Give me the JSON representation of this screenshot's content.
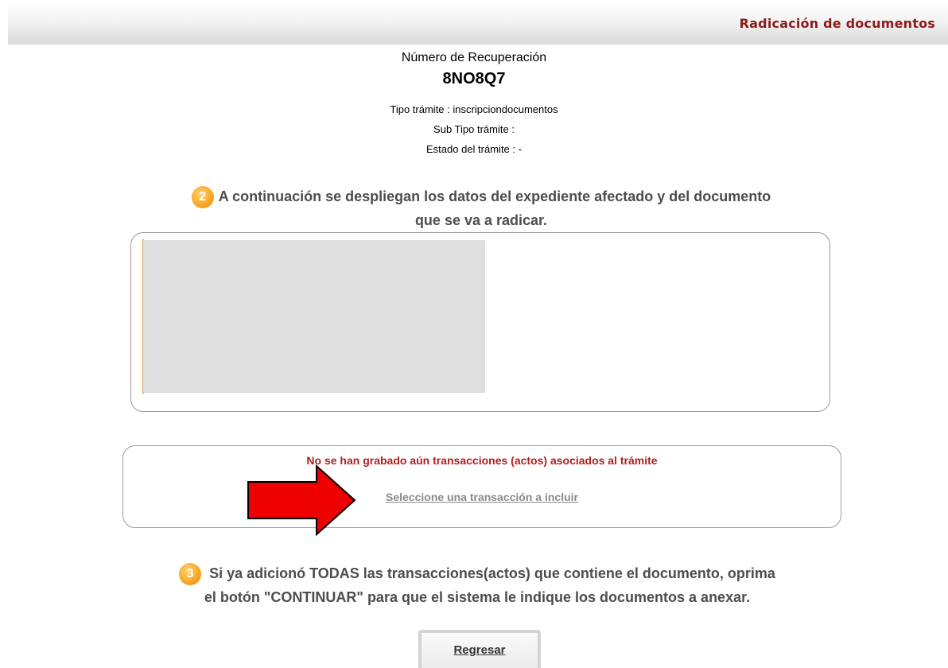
{
  "header": {
    "title": "Radicación de documentos"
  },
  "recovery": {
    "label": "Número de Recuperación",
    "code": "8NO8Q7",
    "tipo_tramite": "Tipo trámite : inscripciondocumentos",
    "sub_tipo_tramite": "Sub Tipo trámite :",
    "estado_tramite": "Estado del trámite : -"
  },
  "step2": {
    "number": "2",
    "text_line1": "A continuación se despliegan los datos del expediente afectado y del documento",
    "text_line2": "que se va a radicar."
  },
  "transactions": {
    "message": "No se han grabado aún transacciones (actos) asociados al trámite",
    "select_link": "Seleccione una transacción a incluir"
  },
  "step3": {
    "number": "3",
    "text_line1": "Si ya adicionó TODAS las transacciones(actos) que contiene el documento, oprima",
    "text_line2": "el botón \"CONTINUAR\" para que el sistema le indique los documentos a anexar."
  },
  "buttons": {
    "back_label": "Regresar"
  },
  "colors": {
    "header_title": "#8b1a1a",
    "error_text": "#b01e1e",
    "step_badge": "#f9a826",
    "annotation_arrow": "#ee0000"
  },
  "icons": {
    "annotation": "red-arrow-right-icon"
  }
}
